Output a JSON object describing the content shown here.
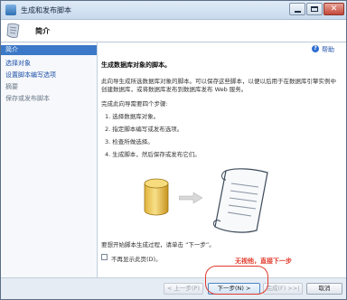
{
  "window": {
    "title": "生成和发布脚本",
    "close_glyph": "✕"
  },
  "header": {
    "title": "简介"
  },
  "sidebar": {
    "items": [
      {
        "label": "简介",
        "state": "active"
      },
      {
        "label": "选择对象",
        "state": "link"
      },
      {
        "label": "设置脚本编写选项",
        "state": "link"
      },
      {
        "label": "摘要",
        "state": "dim"
      },
      {
        "label": "保存或发布脚本",
        "state": "dim"
      }
    ]
  },
  "content": {
    "help": {
      "icon_glyph": "?",
      "label": "帮助"
    },
    "heading": "生成数据库对象的脚本。",
    "description_lines": [
      "此向导生成所选数据库对象的脚本。可以保存这些脚本，以便以后用于在数据库引擎实例中",
      "创建数据库，或将数据库发布到数据库发布 Web 服务。"
    ],
    "steps_intro": "完成此向导需要四个步骤:",
    "steps": [
      "1.  选择数据库对象。",
      "2.  指定脚本编写或发布选项。",
      "3.  检查所做选择。",
      "4.  生成脚本，然后保存或发布它们。"
    ],
    "start_prompt": "要想开始脚本生成过程，请单击 “下一步”。",
    "dont_show_again": "不再显示此页(D)。"
  },
  "footer": {
    "buttons": [
      {
        "label": "< 上一步(P)",
        "enabled": false
      },
      {
        "label": "下一步(N) >",
        "enabled": true
      },
      {
        "label": "完成(F) >>|",
        "enabled": false
      },
      {
        "label": "取消",
        "enabled": true
      }
    ]
  },
  "annotation": {
    "text": "无视他，直接下一步",
    "color": "#e23a2c"
  },
  "colors": {
    "accent": "#3b78c7",
    "link": "#1d50a8"
  }
}
